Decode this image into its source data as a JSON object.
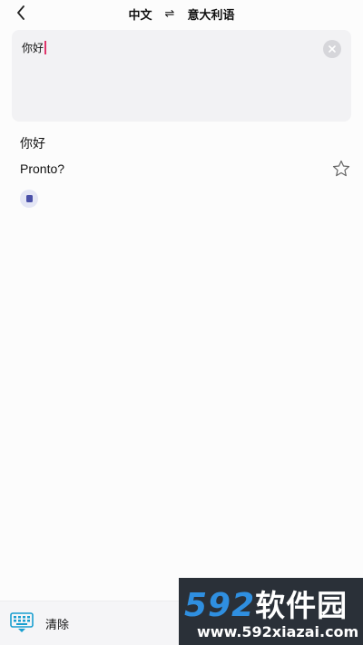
{
  "header": {
    "source_lang": "中文",
    "swap_symbol": "⇌",
    "target_lang": "意大利语"
  },
  "input": {
    "value": "你好"
  },
  "result": {
    "source": "你好",
    "translation": "Pronto?"
  },
  "bottom_bar": {
    "clear_label": "清除"
  },
  "watermark": {
    "brand_number": "592",
    "brand_name": "软件园",
    "url": "www.592xiazai.com"
  },
  "colors": {
    "accent": "#4a50a8",
    "caret": "#e0356b",
    "keyboard_icon": "#1a9fd0"
  },
  "icons": [
    "back-arrow-icon",
    "swap-icon",
    "clear-circle-icon",
    "star-icon",
    "speaker-icon",
    "keyboard-icon"
  ]
}
